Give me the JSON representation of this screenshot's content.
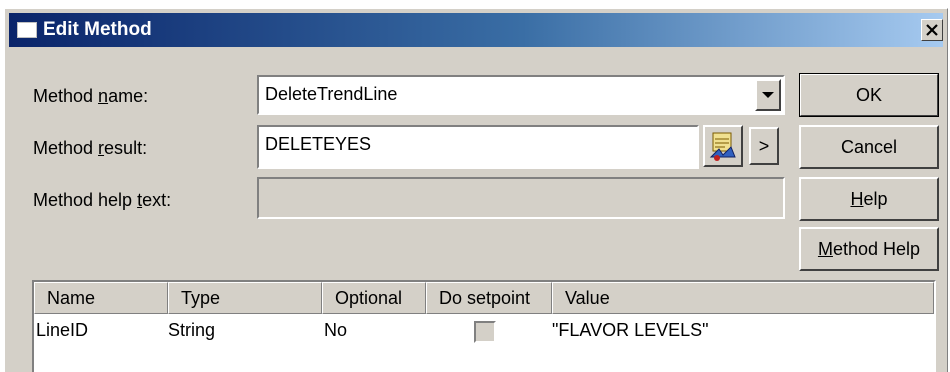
{
  "window": {
    "title": "Edit Method",
    "close_glyph": "✕"
  },
  "form": {
    "method_name": {
      "label_pre": "Method ",
      "label_key": "n",
      "label_post": "ame:",
      "value": "DeleteTrendLine"
    },
    "method_result": {
      "label_pre": "Method ",
      "label_key": "r",
      "label_post": "esult:",
      "value": "DELETEYES"
    },
    "method_help_text": {
      "label_pre": "Method help ",
      "label_key": "t",
      "label_post": "ext:",
      "value": ""
    }
  },
  "buttons": {
    "ok": "OK",
    "cancel": "Cancel",
    "help_key": "H",
    "help_rest": "elp",
    "method_help_key": "M",
    "method_help_rest": "ethod Help",
    "arrow": ">"
  },
  "table": {
    "columns": [
      "Name",
      "Type",
      "Optional",
      "Do setpoint",
      "Value"
    ],
    "rows": [
      {
        "name": "LineID",
        "type": "String",
        "optional": "No",
        "do_setpoint": false,
        "value": "\"FLAVOR LEVELS\""
      }
    ]
  },
  "icons": [
    "window-icon",
    "close-icon",
    "dropdown-arrow-icon",
    "browse-tag-icon"
  ]
}
